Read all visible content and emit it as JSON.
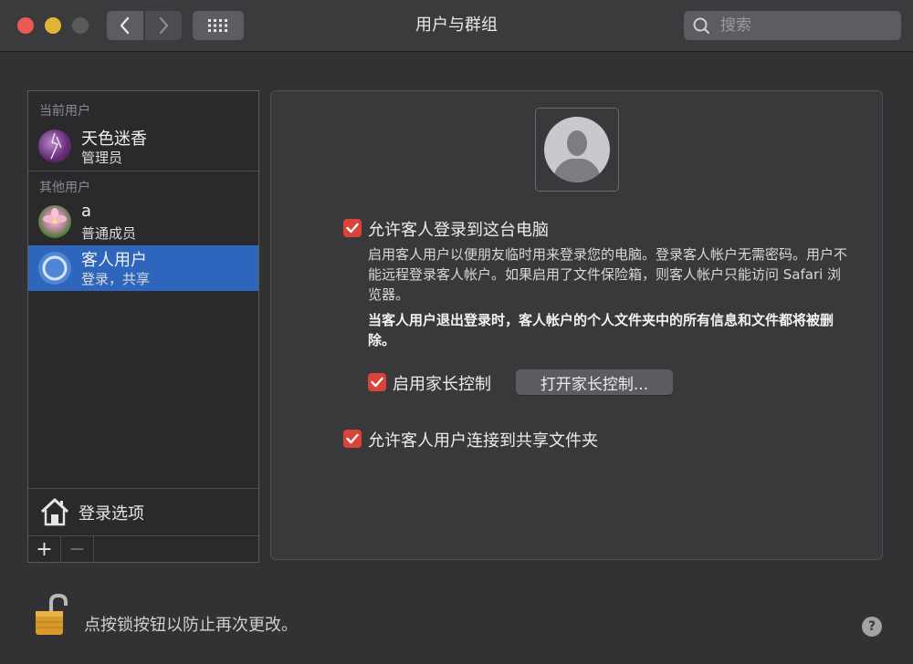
{
  "window": {
    "title": "用户与群组",
    "search_placeholder": "搜索"
  },
  "sidebar": {
    "current_users_label": "当前用户",
    "other_users_label": "其他用户",
    "current_user": {
      "name": "天色迷香",
      "role": "管理员"
    },
    "other_users": [
      {
        "name": "a",
        "role": "普通成员"
      },
      {
        "name": "客人用户",
        "role": "登录，共享",
        "selected": true
      }
    ],
    "login_options_label": "登录选项",
    "add_label": "+",
    "remove_label": "−"
  },
  "guest_panel": {
    "allow_login_label": "允许客人登录到这台电脑",
    "allow_login_checked": true,
    "description": "启用客人用户以便朋友临时用来登录您的电脑。登录客人帐户无需密码。用户不能远程登录客人帐户。如果启用了文件保险箱，则客人帐户只能访问 Safari 浏览器。",
    "warning": "当客人用户退出登录时，客人帐户的个人文件夹中的所有信息和文件都将被删除。",
    "parental_label": "启用家长控制",
    "parental_checked": true,
    "parental_button": "打开家长控制...",
    "shared_folders_label": "允许客人用户连接到共享文件夹",
    "shared_folders_checked": true
  },
  "footer": {
    "lock_text": "点按锁按钮以防止再次更改。",
    "help_label": "?"
  },
  "colors": {
    "accent": "#2f66bd",
    "checkbox": "#d9433a",
    "close": "#ec5a52",
    "minimize": "#e3b434"
  }
}
